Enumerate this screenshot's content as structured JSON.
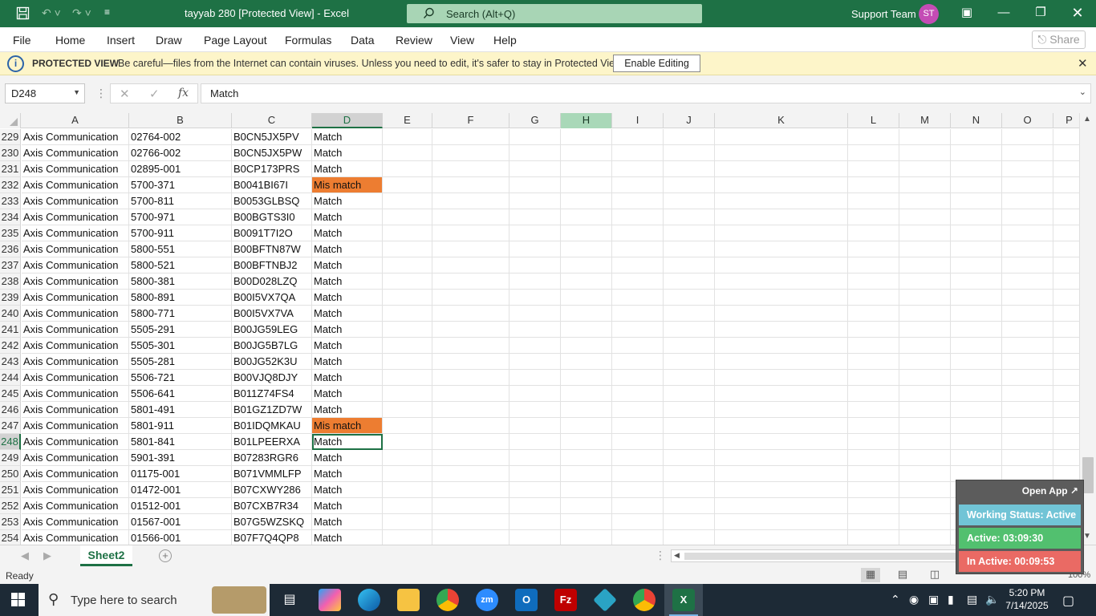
{
  "titlebar": {
    "title": "tayyab 280  [Protected View]  -  Excel",
    "search_placeholder": "Search (Alt+Q)",
    "user": "Support Team",
    "avatar_initials": "ST"
  },
  "menu": {
    "items": [
      "File",
      "Home",
      "Insert",
      "Draw",
      "Page Layout",
      "Formulas",
      "Data",
      "Review",
      "View",
      "Help"
    ],
    "share": "Share"
  },
  "protected_view": {
    "title": "PROTECTED VIEW",
    "message": "Be careful—files from the Internet can contain viruses. Unless you need to edit, it's safer to stay in Protected View.",
    "button": "Enable Editing"
  },
  "formula_bar": {
    "name_box": "D248",
    "fx": "fx",
    "value": "Match"
  },
  "columns": [
    "A",
    "B",
    "C",
    "D",
    "E",
    "F",
    "G",
    "H",
    "I",
    "J",
    "K",
    "L",
    "M",
    "N",
    "O",
    "P"
  ],
  "rows": [
    {
      "n": "229",
      "a": "Axis Communication",
      "b": "02764-002",
      "c": "B0CN5JX5PV",
      "d": "Match"
    },
    {
      "n": "230",
      "a": "Axis Communication",
      "b": "02766-002",
      "c": "B0CN5JX5PW",
      "d": "Match"
    },
    {
      "n": "231",
      "a": "Axis Communication",
      "b": "02895-001",
      "c": "B0CP173PRS",
      "d": "Match"
    },
    {
      "n": "232",
      "a": "Axis Communication",
      "b": "5700-371",
      "c": "B0041BI67I",
      "d": "Mis match",
      "mis": true
    },
    {
      "n": "233",
      "a": "Axis Communication",
      "b": "5700-811",
      "c": "B0053GLBSQ",
      "d": "Match"
    },
    {
      "n": "234",
      "a": "Axis Communication",
      "b": "5700-971",
      "c": "B00BGTS3I0",
      "d": "Match"
    },
    {
      "n": "235",
      "a": "Axis Communication",
      "b": "5700-911",
      "c": "B0091T7I2O",
      "d": "Match"
    },
    {
      "n": "236",
      "a": "Axis Communication",
      "b": "5800-551",
      "c": "B00BFTN87W",
      "d": "Match"
    },
    {
      "n": "237",
      "a": "Axis Communication",
      "b": "5800-521",
      "c": "B00BFTNBJ2",
      "d": "Match"
    },
    {
      "n": "238",
      "a": "Axis Communication",
      "b": "5800-381",
      "c": "B00D028LZQ",
      "d": "Match"
    },
    {
      "n": "239",
      "a": "Axis Communication",
      "b": "5800-891",
      "c": "B00I5VX7QA",
      "d": "Match"
    },
    {
      "n": "240",
      "a": "Axis Communication",
      "b": "5800-771",
      "c": "B00I5VX7VA",
      "d": "Match"
    },
    {
      "n": "241",
      "a": "Axis Communication",
      "b": "5505-291",
      "c": "B00JG59LEG",
      "d": "Match"
    },
    {
      "n": "242",
      "a": "Axis Communication",
      "b": "5505-301",
      "c": "B00JG5B7LG",
      "d": "Match"
    },
    {
      "n": "243",
      "a": "Axis Communication",
      "b": "5505-281",
      "c": "B00JG52K3U",
      "d": "Match"
    },
    {
      "n": "244",
      "a": "Axis Communication",
      "b": "5506-721",
      "c": "B00VJQ8DJY",
      "d": "Match"
    },
    {
      "n": "245",
      "a": "Axis Communication",
      "b": "5506-641",
      "c": "B011Z74FS4",
      "d": "Match"
    },
    {
      "n": "246",
      "a": "Axis Communication",
      "b": "5801-491",
      "c": "B01GZ1ZD7W",
      "d": "Match"
    },
    {
      "n": "247",
      "a": "Axis Communication",
      "b": "5801-911",
      "c": "B01IDQMKAU",
      "d": "Mis match",
      "mis": true
    },
    {
      "n": "248",
      "a": "Axis Communication",
      "b": "5801-841",
      "c": "B01LPEERXA",
      "d": "Match",
      "active": true
    },
    {
      "n": "249",
      "a": "Axis Communication",
      "b": "5901-391",
      "c": "B07283RGR6",
      "d": "Match"
    },
    {
      "n": "250",
      "a": "Axis Communication",
      "b": "01175-001",
      "c": "B071VMMLFP",
      "d": "Match"
    },
    {
      "n": "251",
      "a": "Axis Communication",
      "b": "01472-001",
      "c": "B07CXWY286",
      "d": "Match"
    },
    {
      "n": "252",
      "a": "Axis Communication",
      "b": "01512-001",
      "c": "B07CXB7R34",
      "d": "Match"
    },
    {
      "n": "253",
      "a": "Axis Communication",
      "b": "01567-001",
      "c": "B07G5WZSKQ",
      "d": "Match"
    },
    {
      "n": "254",
      "a": "Axis Communication",
      "b": "01566-001",
      "c": "B07F7Q4QP8",
      "d": "Match"
    }
  ],
  "sheet_tab": "Sheet2",
  "status": {
    "ready": "Ready",
    "zoom": "100%"
  },
  "widget": {
    "open_app": "Open App ↗",
    "working_status": "Working Status: Active",
    "active": "Active: 03:09:30",
    "inactive": "In Active: 00:09:53"
  },
  "taskbar": {
    "search_placeholder": "Type here to search",
    "time": "5:20 PM",
    "date": "7/14/2025",
    "apps": [
      "task-view-icon",
      "copilot-icon",
      "edge-icon",
      "file-explorer-icon",
      "chrome-icon",
      "zoom-icon",
      "outlook-icon",
      "filezilla-icon",
      "app-icon",
      "chrome-profile-icon",
      "excel-icon"
    ]
  },
  "colors": {
    "accent": "#1e7145",
    "mismatch": "#ed7d31",
    "taskbar": "#1d2a36"
  }
}
